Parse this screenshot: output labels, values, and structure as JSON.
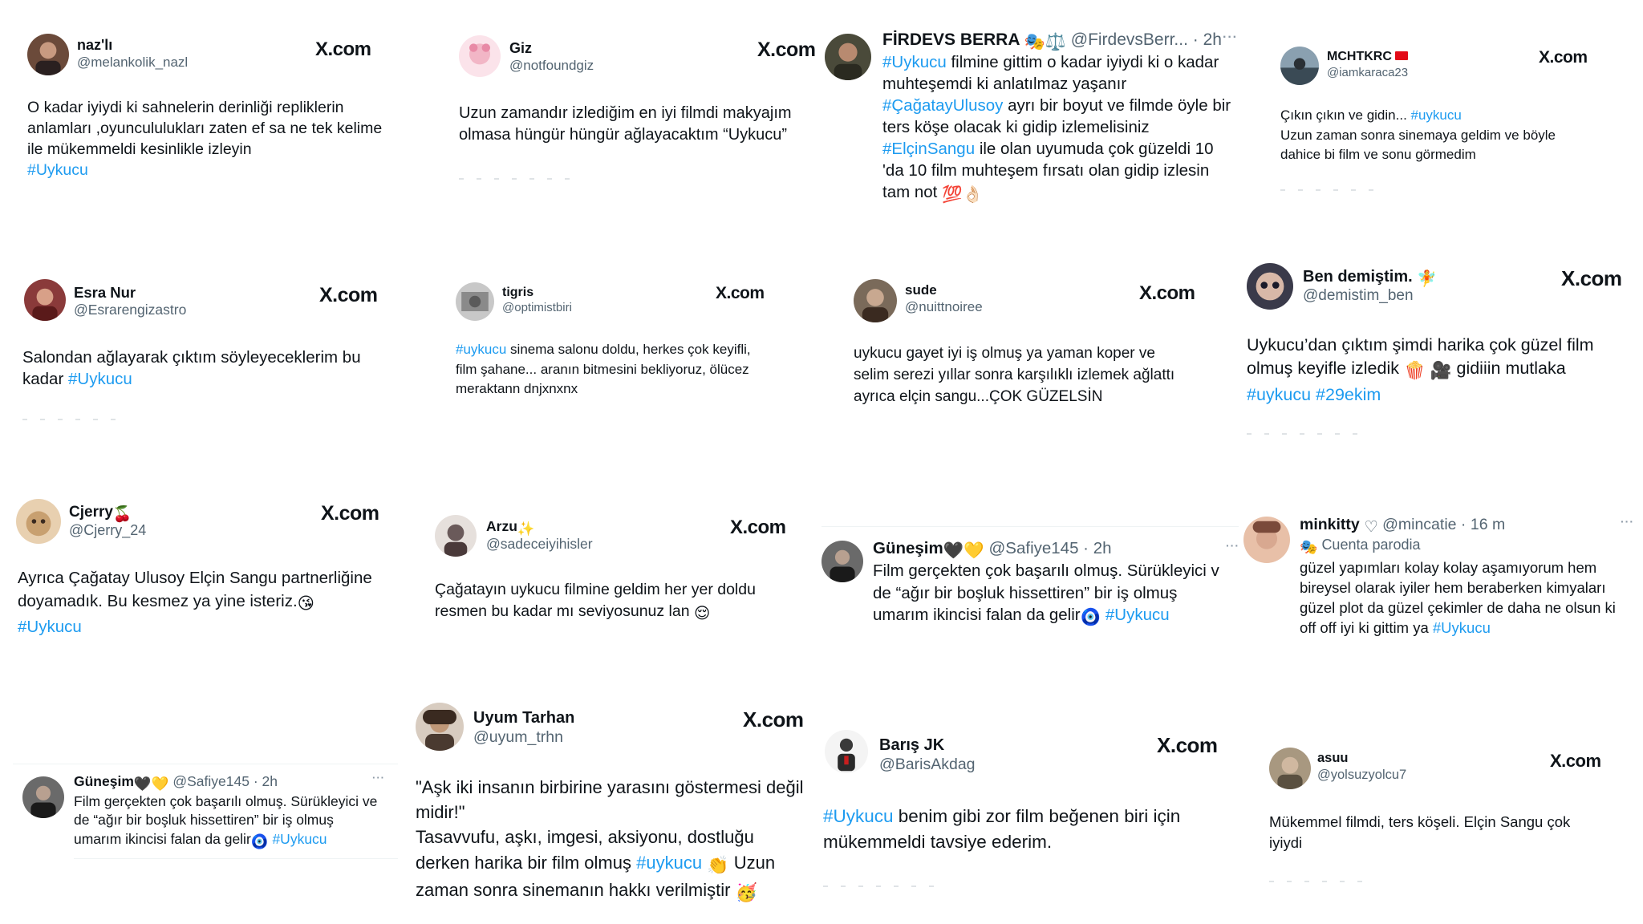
{
  "x_logo": "X.com",
  "tweets": [
    {
      "name": "naz'lı",
      "handle": "@melankolik_nazl",
      "lines": [
        "O kadar iyiydi ki sahnelerin derinliği repliklerin",
        "anlamları ,oyuncululukları zaten ef sa ne tek kelime",
        "ile mükemmeldi kesinlikle izleyin"
      ],
      "tag": "#Uykucu",
      "avatar_color": "#6b4a3a"
    },
    {
      "name": "Giz",
      "handle": "@notfoundgiz",
      "lines": [
        "Uzun zamandır izlediğim en iyi filmdi makyajım",
        "olmasa hüngür hüngür ağlayacaktım “Uykucu”"
      ],
      "avatar_color": "#f2b6c6"
    },
    {
      "name": "FİRDEVS BERRA",
      "handle": "@FirdevsBerr...",
      "time": "2h",
      "avatar_color": "#4a4a3a",
      "text_1_tag": "#Uykucu",
      "text_1": " filmine gittim o kadar iyiydi ki o kadar",
      "text_2": "muhteşemdi ki anlatılmaz yaşanır",
      "text_3_tag": "#ÇağatayUlusoy",
      "text_3": " ayrı bir boyut ve filmde öyle bir",
      "text_4": "ters köşe olacak ki gidip izlemelisiniz",
      "text_5_tag": "#ElçinSangu",
      "text_5": "  ile olan  uyumuda  çok güzeldi 10",
      "text_6": "'da 10 film muhteşem fırsatı olan gidip izlesin",
      "text_7": "tam not"
    },
    {
      "name": "MCHTKRC",
      "handle": "@iamkaraca23",
      "line1_text": "Çıkın çıkın ve gidin... ",
      "line1_tag": "#uykucu",
      "lines": [
        "Uzun zaman sonra sinemaya geldim ve böyle",
        "dahice bi film ve sonu görmedim"
      ],
      "avatar_color": "#5a6b7a"
    },
    {
      "name": "Esra Nur",
      "handle": "@Esrarengizastro",
      "lines": [
        "Salondan ağlayarak çıktım söyleyeceklerim bu"
      ],
      "line2_text": "kadar ",
      "tag": "#Uykucu",
      "avatar_color": "#8a3a3a"
    },
    {
      "name": "tigris",
      "handle": "@optimistbiri",
      "line1_tag": "#uykucu",
      "line1_text": " sinema salonu doldu, herkes çok keyifli,",
      "lines": [
        "film şahane... aranın bitmesini bekliyoruz, ölücez",
        "meraktann dnjxnxnx"
      ],
      "avatar_color": "#9a9a9a"
    },
    {
      "name": "sude",
      "handle": "@nuittnoiree",
      "lines": [
        "uykucu gayet iyi iş olmuş ya yaman koper ve",
        "selim serezi yıllar sonra karşılıklı izlemek ağlattı",
        "ayrıca elçin sangu...ÇOK GÜZELSİN"
      ],
      "avatar_color": "#7a6a5a"
    },
    {
      "name": "Ben demiştim.",
      "handle": "@demistim_ben",
      "lines": [
        "Uykucu’dan çıktım şimdi harika çok güzel film"
      ],
      "line2_text": "olmuş keyifle izledik",
      "line2_text_b": " gidiiin mutlaka",
      "tags": "#uykucu #29ekim",
      "avatar_color": "#3a3a4a"
    },
    {
      "name": "Cjerry",
      "handle": "@Cjerry_24",
      "lines": [
        "Ayrıca Çağatay Ulusoy Elçin Sangu partnerliğine",
        "doyamadık. Bu kesmez ya yine isteriz."
      ],
      "tag": "#Uykucu",
      "avatar_color": "#c8a070"
    },
    {
      "name": "Arzu",
      "handle": "@sadeceiyihisler",
      "lines": [
        "Çağatayın uykucu filmine geldim her yer doldu",
        "resmen bu kadar mı seviyosunuz lan"
      ],
      "avatar_color": "#6a5a5a"
    },
    {
      "name": "Güneşim",
      "handle": "@Safiye145",
      "time": "2h",
      "lines": [
        "Film gerçekten çok başarılı olmuş. Sürükleyici v",
        "de “ağır bir boşluk hissettiren” bir iş olmuş"
      ],
      "line3_text": "umarım ikincisi falan da gelir",
      "tag": "#Uykucu",
      "avatar_color": "#3a3a3a"
    },
    {
      "name": "minkitty",
      "handle": "@mincatie",
      "time": "16 m",
      "sub": "Cuenta parodia",
      "lines": [
        "güzel yapımları kolay kolay aşamıyorum hem",
        "bireysel olarak iyiler hem beraberken kimyaları",
        "güzel plot da güzel çekimler de daha ne olsun ki"
      ],
      "line4_text": "off off iyi ki gittim ya ",
      "tag": "#Uykucu",
      "avatar_color": "#d8a890"
    },
    {
      "name": "Güneşim",
      "handle": "@Safiye145",
      "time": "2h",
      "lines": [
        "Film gerçekten çok başarılı olmuş. Sürükleyici ve",
        "de “ağır bir boşluk hissettiren” bir iş olmuş"
      ],
      "line3_text": "umarım ikincisi falan da gelir",
      "tag": "#Uykucu",
      "avatar_color": "#3a3a3a"
    },
    {
      "name": "Uyum Tarhan",
      "handle": "@uyum_trhn",
      "lines": [
        "\"Aşk iki insanın birbirine yarasını göstermesi değil",
        "midir!\"",
        "Tasavvufu, aşkı, imgesi, aksiyonu, dostluğu"
      ],
      "line4_text": "derken harika bir film olmuş ",
      "tag": "#uykucu",
      "line4_after": " Uzun",
      "line5_text": "zaman sonra sinemanın hakkı verilmiştir",
      "avatar_color": "#4a3a30"
    },
    {
      "name": "Barış JK",
      "handle": "@BarisAkdag",
      "tag": "#Uykucu",
      "line1_text": " benim gibi zor film beğenen biri için",
      "lines": [
        "mükemmeldi tavsiye ederim."
      ],
      "avatar_color": "#eaeaea"
    },
    {
      "name": "asuu",
      "handle": "@yolsuzyolcu7",
      "lines": [
        "Mükemmel filmdi, ters köşeli. Elçin Sangu çok",
        "iyiydi"
      ],
      "avatar_color": "#6a6050"
    }
  ]
}
